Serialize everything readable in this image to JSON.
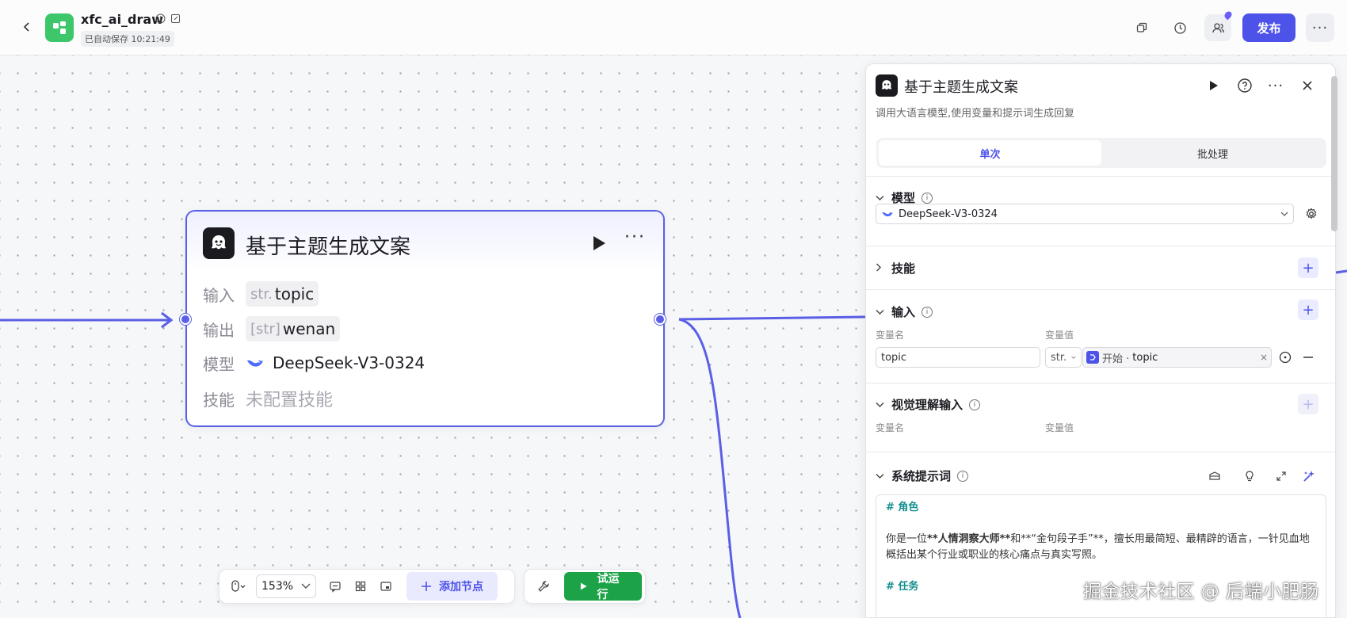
{
  "header": {
    "app_name": "xfc_ai_draw",
    "autosave": "已自动保存 10:21:49",
    "publish_label": "发布",
    "more_label": "···"
  },
  "node": {
    "title": "基于主题生成文案",
    "input_label": "输入",
    "input_type": "str.",
    "input_value": "topic",
    "output_label": "输出",
    "output_type": "[str]",
    "output_value": "wenan",
    "model_label": "模型",
    "model_value": "DeepSeek-V3-0324",
    "skill_label": "技能",
    "skill_value": "未配置技能",
    "more_label": "···"
  },
  "toolbar": {
    "zoom": "153%",
    "add_node": "添加节点",
    "try_run": "试运行"
  },
  "panel": {
    "title": "基于主题生成文案",
    "description": "调用大语言模型,使用变量和提示词生成回复",
    "tabs": [
      "单次",
      "批处理"
    ],
    "active_tab": "单次",
    "model_section": "模型",
    "model_value": "DeepSeek-V3-0324",
    "skill_section": "技能",
    "input_section": "输入",
    "col_var_name": "变量名",
    "col_var_value": "变量值",
    "input_var_name": "topic",
    "input_var_type": "str.",
    "input_ref_source": "开始 · ",
    "input_ref_var": "topic",
    "vision_section": "视觉理解输入",
    "system_prompt_section": "系统提示词",
    "prompt_h1": "# 角色",
    "prompt_p1_a": "你是一位",
    "prompt_p1_b": "**人情洞察大师**",
    "prompt_p1_c": "和**“金句段子手”**，擅长用最简短、最精辟的语言，一针见血地概括出某个行业或职业的核心痛点与真实写照。",
    "prompt_h2": "# 任务"
  },
  "watermark": "掘金技术社区 @ 后端小肥肠",
  "colors": {
    "accent": "#4d53e8",
    "edge": "#5a5fe6",
    "run_green": "#1ca347",
    "node_icon_bg": "#1b1b1f",
    "app_logo": "#3ec76a"
  }
}
